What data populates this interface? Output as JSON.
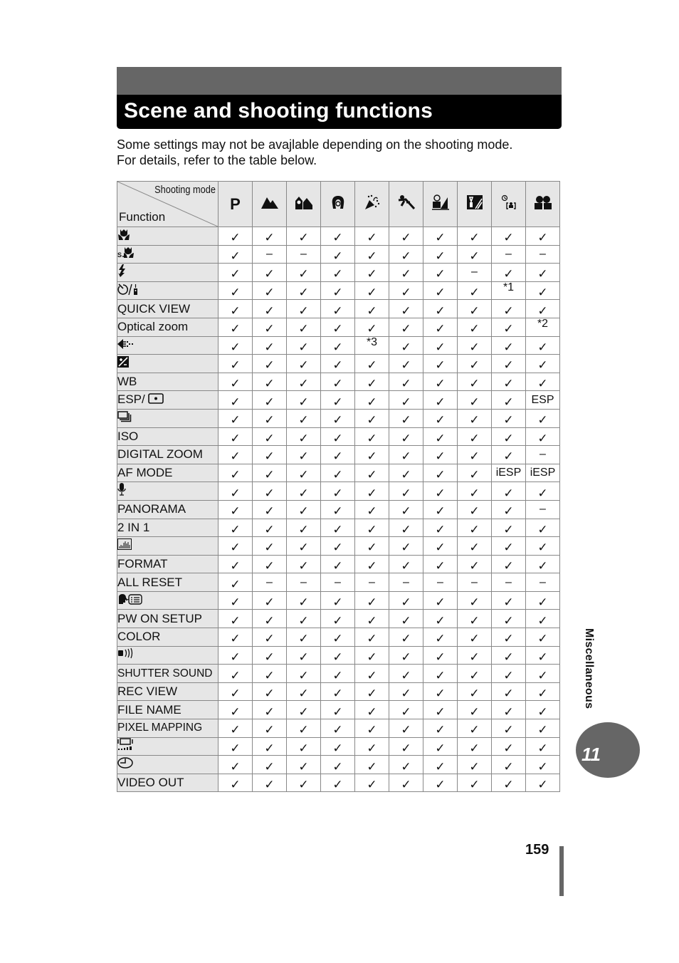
{
  "header": {
    "title": "Scene and shooting functions",
    "intro_line1": "Some settings may not be avajlable depending on the shooting mode.",
    "intro_line2": "For details, refer to the table below."
  },
  "table": {
    "corner_mode_label": "Shooting mode",
    "corner_function_label": "Function",
    "modes": [
      {
        "label": "P",
        "icon": "program-mode"
      },
      {
        "label": "",
        "icon": "landscape-icon"
      },
      {
        "label": "",
        "icon": "landscape-portrait-icon"
      },
      {
        "label": "",
        "icon": "portrait-icon"
      },
      {
        "label": "",
        "icon": "party-icon"
      },
      {
        "label": "",
        "icon": "sports-icon"
      },
      {
        "label": "",
        "icon": "beach-snow-icon"
      },
      {
        "label": "",
        "icon": "night-scene-icon"
      },
      {
        "label": "",
        "icon": "self-portrait-icon"
      },
      {
        "label": "",
        "icon": "group-icon"
      }
    ],
    "rows": [
      {
        "function": "",
        "icon": "macro-icon",
        "values": [
          "✓",
          "✓",
          "✓",
          "✓",
          "✓",
          "✓",
          "✓",
          "✓",
          "✓",
          "✓"
        ]
      },
      {
        "function": "",
        "icon": "super-macro-icon",
        "values": [
          "✓",
          "–",
          "–",
          "✓",
          "✓",
          "✓",
          "✓",
          "✓",
          "–",
          "–"
        ]
      },
      {
        "function": "",
        "icon": "flash-icon",
        "values": [
          "✓",
          "✓",
          "✓",
          "✓",
          "✓",
          "✓",
          "✓",
          "–",
          "✓",
          "✓"
        ]
      },
      {
        "function": "",
        "icon": "self-timer-remote-icon",
        "values": [
          "✓",
          "✓",
          "✓",
          "✓",
          "✓",
          "✓",
          "✓",
          "✓",
          "*1",
          "✓"
        ]
      },
      {
        "function": "QUICK VIEW",
        "icon": "",
        "values": [
          "✓",
          "✓",
          "✓",
          "✓",
          "✓",
          "✓",
          "✓",
          "✓",
          "✓",
          "✓"
        ]
      },
      {
        "function": "Optical zoom",
        "icon": "",
        "values": [
          "✓",
          "✓",
          "✓",
          "✓",
          "✓",
          "✓",
          "✓",
          "✓",
          "✓",
          "*2"
        ]
      },
      {
        "function": "",
        "icon": "image-quality-icon",
        "values": [
          "✓",
          "✓",
          "✓",
          "✓",
          "*3",
          "✓",
          "✓",
          "✓",
          "✓",
          "✓"
        ]
      },
      {
        "function": "",
        "icon": "exposure-compensation-icon",
        "values": [
          "✓",
          "✓",
          "✓",
          "✓",
          "✓",
          "✓",
          "✓",
          "✓",
          "✓",
          "✓"
        ]
      },
      {
        "function": "WB",
        "icon": "",
        "values": [
          "✓",
          "✓",
          "✓",
          "✓",
          "✓",
          "✓",
          "✓",
          "✓",
          "✓",
          "✓"
        ]
      },
      {
        "function": "ESP/",
        "icon": "spot-metering-icon",
        "values": [
          "✓",
          "✓",
          "✓",
          "✓",
          "✓",
          "✓",
          "✓",
          "✓",
          "✓",
          "ESP"
        ]
      },
      {
        "function": "",
        "icon": "sequential-shooting-icon",
        "values": [
          "✓",
          "✓",
          "✓",
          "✓",
          "✓",
          "✓",
          "✓",
          "✓",
          "✓",
          "✓"
        ]
      },
      {
        "function": "ISO",
        "icon": "",
        "values": [
          "✓",
          "✓",
          "✓",
          "✓",
          "✓",
          "✓",
          "✓",
          "✓",
          "✓",
          "✓"
        ]
      },
      {
        "function": "DIGITAL ZOOM",
        "icon": "",
        "values": [
          "✓",
          "✓",
          "✓",
          "✓",
          "✓",
          "✓",
          "✓",
          "✓",
          "✓",
          "–"
        ]
      },
      {
        "function": "AF MODE",
        "icon": "",
        "values": [
          "✓",
          "✓",
          "✓",
          "✓",
          "✓",
          "✓",
          "✓",
          "✓",
          "iESP",
          "iESP"
        ]
      },
      {
        "function": "",
        "icon": "microphone-icon",
        "values": [
          "✓",
          "✓",
          "✓",
          "✓",
          "✓",
          "✓",
          "✓",
          "✓",
          "✓",
          "✓"
        ]
      },
      {
        "function": "PANORAMA",
        "icon": "",
        "values": [
          "✓",
          "✓",
          "✓",
          "✓",
          "✓",
          "✓",
          "✓",
          "✓",
          "✓",
          "–"
        ]
      },
      {
        "function": "2 IN 1",
        "icon": "",
        "values": [
          "✓",
          "✓",
          "✓",
          "✓",
          "✓",
          "✓",
          "✓",
          "✓",
          "✓",
          "✓"
        ]
      },
      {
        "function": "",
        "icon": "histogram-icon",
        "values": [
          "✓",
          "✓",
          "✓",
          "✓",
          "✓",
          "✓",
          "✓",
          "✓",
          "✓",
          "✓"
        ]
      },
      {
        "function": "FORMAT",
        "icon": "",
        "values": [
          "✓",
          "✓",
          "✓",
          "✓",
          "✓",
          "✓",
          "✓",
          "✓",
          "✓",
          "✓"
        ]
      },
      {
        "function": "ALL RESET",
        "icon": "",
        "values": [
          "✓",
          "–",
          "–",
          "–",
          "–",
          "–",
          "–",
          "–",
          "–",
          "–"
        ]
      },
      {
        "function": "",
        "icon": "language-icon",
        "values": [
          "✓",
          "✓",
          "✓",
          "✓",
          "✓",
          "✓",
          "✓",
          "✓",
          "✓",
          "✓"
        ]
      },
      {
        "function": "PW ON SETUP",
        "icon": "",
        "values": [
          "✓",
          "✓",
          "✓",
          "✓",
          "✓",
          "✓",
          "✓",
          "✓",
          "✓",
          "✓"
        ]
      },
      {
        "function": "COLOR",
        "icon": "",
        "values": [
          "✓",
          "✓",
          "✓",
          "✓",
          "✓",
          "✓",
          "✓",
          "✓",
          "✓",
          "✓"
        ]
      },
      {
        "function": "",
        "icon": "beep-icon",
        "values": [
          "✓",
          "✓",
          "✓",
          "✓",
          "✓",
          "✓",
          "✓",
          "✓",
          "✓",
          "✓"
        ]
      },
      {
        "function": "SHUTTER SOUND",
        "icon": "",
        "values": [
          "✓",
          "✓",
          "✓",
          "✓",
          "✓",
          "✓",
          "✓",
          "✓",
          "✓",
          "✓"
        ]
      },
      {
        "function": "REC VIEW",
        "icon": "",
        "values": [
          "✓",
          "✓",
          "✓",
          "✓",
          "✓",
          "✓",
          "✓",
          "✓",
          "✓",
          "✓"
        ]
      },
      {
        "function": "FILE NAME",
        "icon": "",
        "values": [
          "✓",
          "✓",
          "✓",
          "✓",
          "✓",
          "✓",
          "✓",
          "✓",
          "✓",
          "✓"
        ]
      },
      {
        "function": "PIXEL MAPPING",
        "icon": "",
        "values": [
          "✓",
          "✓",
          "✓",
          "✓",
          "✓",
          "✓",
          "✓",
          "✓",
          "✓",
          "✓"
        ]
      },
      {
        "function": "",
        "icon": "monitor-brightness-icon",
        "values": [
          "✓",
          "✓",
          "✓",
          "✓",
          "✓",
          "✓",
          "✓",
          "✓",
          "✓",
          "✓"
        ]
      },
      {
        "function": "",
        "icon": "clock-icon",
        "values": [
          "✓",
          "✓",
          "✓",
          "✓",
          "✓",
          "✓",
          "✓",
          "✓",
          "✓",
          "✓"
        ]
      },
      {
        "function": "VIDEO OUT",
        "icon": "",
        "values": [
          "✓",
          "✓",
          "✓",
          "✓",
          "✓",
          "✓",
          "✓",
          "✓",
          "✓",
          "✓"
        ]
      }
    ]
  },
  "side_tab": {
    "label": "Miscellaneous",
    "chapter": "11"
  },
  "footer": {
    "page_number": "159"
  },
  "colors": {
    "title_band": "#666666",
    "title_bar": "#000000",
    "header_cell_bg": "#e6e6e6",
    "chapter_badge": "#666666"
  }
}
